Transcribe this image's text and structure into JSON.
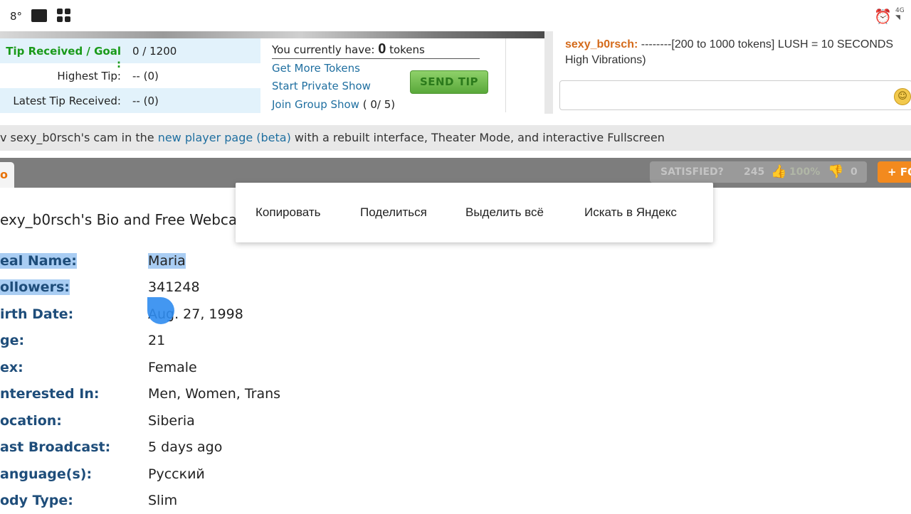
{
  "status_bar": {
    "temperature": "8°",
    "network": "4G"
  },
  "tip_panel": {
    "rows": [
      {
        "label": "Tip Received / Goal :",
        "value": "0 / 1200"
      },
      {
        "label": "Highest Tip:",
        "value": "-- (0)"
      },
      {
        "label": "Latest Tip Received:",
        "value": "-- (0)"
      }
    ]
  },
  "tokens": {
    "prefix": "You currently have:",
    "count": "0",
    "suffix": "tokens",
    "get_more": "Get More Tokens",
    "private_show": "Start Private Show",
    "group_show": "Join Group Show",
    "group_count": "( 0/ 5)",
    "send_tip": "SEND TIP"
  },
  "chat": {
    "user": "sexy_b0rsch:",
    "message": " --------[200 to 1000 tokens] LUSH = 10 SECONDS High Vibrations)"
  },
  "info_bar": {
    "prefix": "v sexy_b0rsch's cam in the ",
    "link": "new player page (beta)",
    "suffix": " with a rebuilt interface, Theater Mode, and interactive Fullscreen"
  },
  "tabs": {
    "active_label": "o"
  },
  "satisfied": {
    "label": "SATISFIED?",
    "up_count": "245",
    "percent": "100%",
    "down_count": "0"
  },
  "follow": {
    "label": "+ FO"
  },
  "bio": {
    "title": "exy_b0rsch's Bio and Free Webcam",
    "rows": [
      {
        "key": "eal Name:",
        "value": "Maria"
      },
      {
        "key": "ollowers:",
        "value": "341248"
      },
      {
        "key": "irth Date:",
        "value": "Aug. 27, 1998"
      },
      {
        "key": "ge:",
        "value": "21"
      },
      {
        "key": "ex:",
        "value": "Female"
      },
      {
        "key": "nterested In:",
        "value": "Men, Women, Trans"
      },
      {
        "key": "ocation:",
        "value": "Siberia"
      },
      {
        "key": "ast Broadcast:",
        "value": "5 days ago"
      },
      {
        "key": "anguage(s):",
        "value": "Русский"
      },
      {
        "key": "ody Type:",
        "value": "Slim"
      }
    ]
  },
  "context_menu": {
    "copy": "Копировать",
    "share": "Поделиться",
    "select_all": "Выделить всё",
    "search_yandex": "Искать в Яндекс"
  }
}
